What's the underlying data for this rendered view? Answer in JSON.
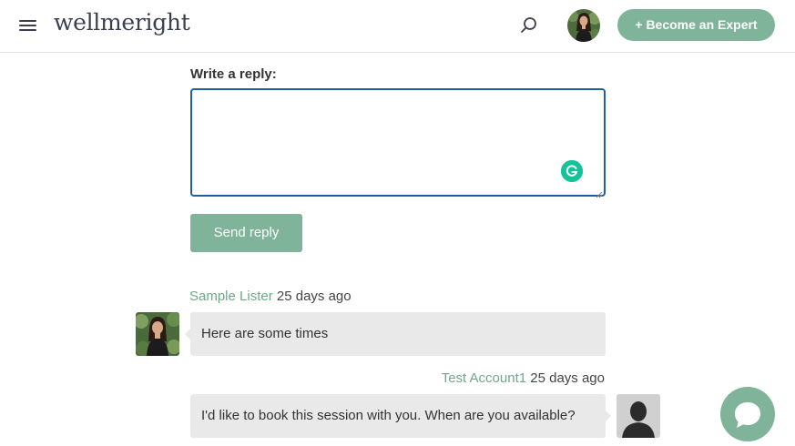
{
  "header": {
    "logo_text": "wellmeright",
    "expert_button": "+ Become an Expert",
    "icons": {
      "menu": "hamburger-menu-icon",
      "search": "search-icon"
    }
  },
  "reply_form": {
    "label": "Write a reply:",
    "value": "",
    "placeholder": "",
    "send_button": "Send reply"
  },
  "messages": [
    {
      "author": "Sample Lister",
      "time": "25 days ago",
      "text": "Here are some times",
      "side": "left"
    },
    {
      "author": "Test Account1",
      "time": "25 days ago",
      "text": "I'd like to book this session with you. When are you available?",
      "side": "right"
    }
  ],
  "colors": {
    "accent": "#7fb39a",
    "focus_border": "#1f5f9c",
    "bubble_bg": "#e9e9e9",
    "grammarly": "#15c39a"
  }
}
